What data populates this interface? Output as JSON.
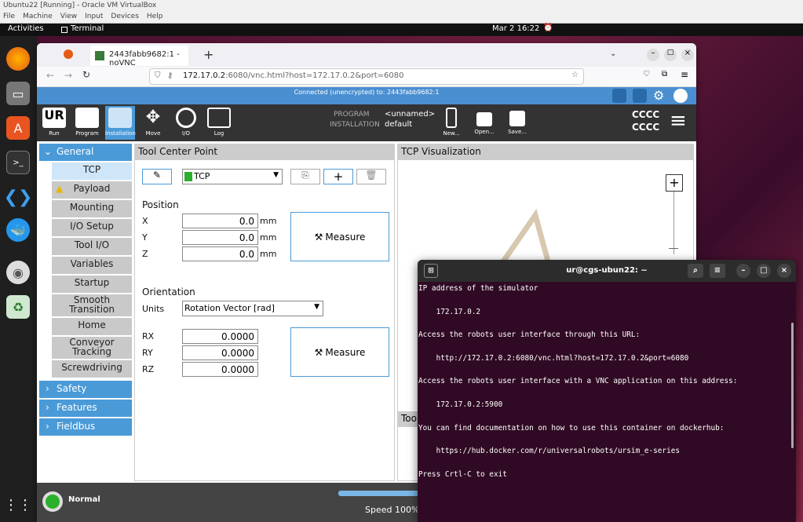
{
  "vbox": {
    "title": "Ubuntu22 [Running] - Oracle VM VirtualBox",
    "menu": [
      "File",
      "Machine",
      "View",
      "Input",
      "Devices",
      "Help"
    ]
  },
  "topbar": {
    "activities": "Activities",
    "app": "Terminal",
    "clock": "Mar 2  16:22"
  },
  "browser": {
    "tab_title": "2443fabb9682:1 - noVNC",
    "url_host": "172.17.0.2",
    "url_rest": ":6080/vnc.html?host=172.17.0.2&port=6080",
    "vnc_status": "Connected (unencrypted) to: 2443fabb9682:1"
  },
  "ur_header": {
    "buttons": [
      "Run",
      "Program",
      "Installation",
      "Move",
      "I/O",
      "Log"
    ],
    "program_label": "PROGRAM",
    "program_value": "<unnamed>",
    "installation_label": "INSTALLATION",
    "installation_value": "default",
    "file_buttons": [
      "New...",
      "Open...",
      "Save..."
    ],
    "cccc1": "CCCC",
    "cccc2": "CCCC"
  },
  "sidebar": {
    "general": "General",
    "items": [
      "TCP",
      "Payload",
      "Mounting",
      "I/O Setup",
      "Tool I/O",
      "Variables",
      "Startup",
      "Smooth Transition",
      "Home",
      "Conveyor Tracking",
      "Screwdriving"
    ],
    "sections": [
      "Safety",
      "Features",
      "Fieldbus"
    ]
  },
  "tcp_panel": {
    "title": "Tool Center Point",
    "tcp_select": "TCP",
    "position_label": "Position",
    "x_label": "X",
    "x_value": "0.0",
    "y_label": "Y",
    "y_value": "0.0",
    "z_label": "Z",
    "z_value": "0.0",
    "unit_mm": "mm",
    "measure": "Measure",
    "orientation_label": "Orientation",
    "units_label": "Units",
    "units_value": "Rotation Vector [rad]",
    "rx_label": "RX",
    "rx_value": "0.0000",
    "ry_label": "RY",
    "ry_value": "0.0000",
    "rz_label": "RZ",
    "rz_value": "0.0000"
  },
  "viz_panel": {
    "title": "TCP Visualization",
    "tool_label": "Too"
  },
  "footer": {
    "status": "Normal",
    "speed": "Speed 100%"
  },
  "terminal": {
    "title": "ur@cgs-ubun22: ~",
    "lines": [
      "IP address of the simulator",
      "",
      "    172.17.0.2",
      "",
      "Access the robots user interface through this URL:",
      "",
      "    http://172.17.0.2:6080/vnc.html?host=172.17.0.2&port=6080",
      "",
      "Access the robots user interface with a VNC application on this address:",
      "",
      "    172.17.0.2:5900",
      "",
      "You can find documentation on how to use this container on dockerhub:",
      "",
      "    https://hub.docker.com/r/universalrobots/ursim_e-series",
      "",
      "Press Crtl-C to exit"
    ]
  }
}
